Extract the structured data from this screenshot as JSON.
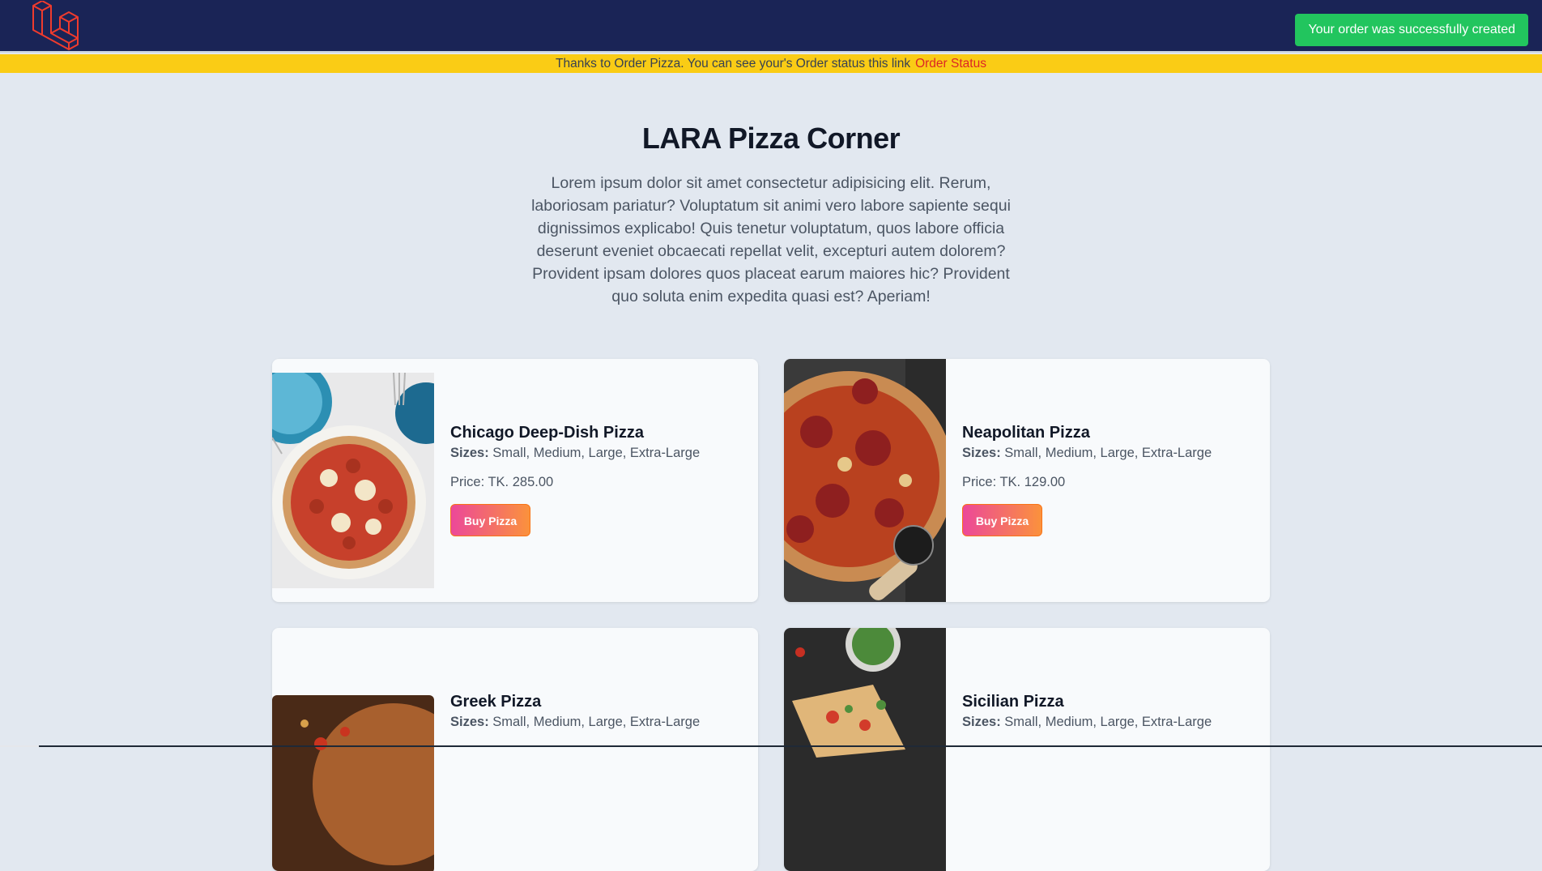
{
  "navbar": {
    "logo_icon": "laravel-logo-icon",
    "toast": "Your order was successfully created",
    "toast_color": "#22c55e",
    "bg_color": "#1a2456"
  },
  "notice": {
    "text": "Thanks to Order Pizza. You can see your's Order status this link",
    "link": "Order Status",
    "bg_color": "#facc15"
  },
  "hero": {
    "title": "LARA Pizza Corner",
    "description": "Lorem ipsum dolor sit amet consectetur adipisicing elit. Rerum, laboriosam pariatur? Voluptatum sit animi vero labore sapiente sequi dignissimos explicabo! Quis tenetur voluptatum, quos labore officia deserunt eveniet obcaecati repellat velit, excepturi autem dolorem? Provident ipsam dolores quos placeat earum maiores hic? Provident quo soluta enim expedita quasi est? Aperiam!"
  },
  "pizzas": [
    {
      "name": "Chicago Deep-Dish Pizza",
      "sizes_label": "Sizes:",
      "sizes": "Small, Medium, Large, Extra-Large",
      "price": "Price: TK. 285.00",
      "button": "Buy Pizza"
    },
    {
      "name": "Neapolitan Pizza",
      "sizes_label": "Sizes:",
      "sizes": "Small, Medium, Large, Extra-Large",
      "price": "Price: TK. 129.00",
      "button": "Buy Pizza"
    },
    {
      "name": "Greek Pizza",
      "sizes_label": "Sizes:",
      "sizes": "Small, Medium, Large, Extra-Large"
    },
    {
      "name": "Sicilian Pizza",
      "sizes_label": "Sizes:",
      "sizes": "Small, Medium, Large, Extra-Large"
    }
  ],
  "theme": {
    "accent_from": "#ec4899",
    "accent_to": "#fb923c",
    "page_bg": "#e2e8f0"
  }
}
